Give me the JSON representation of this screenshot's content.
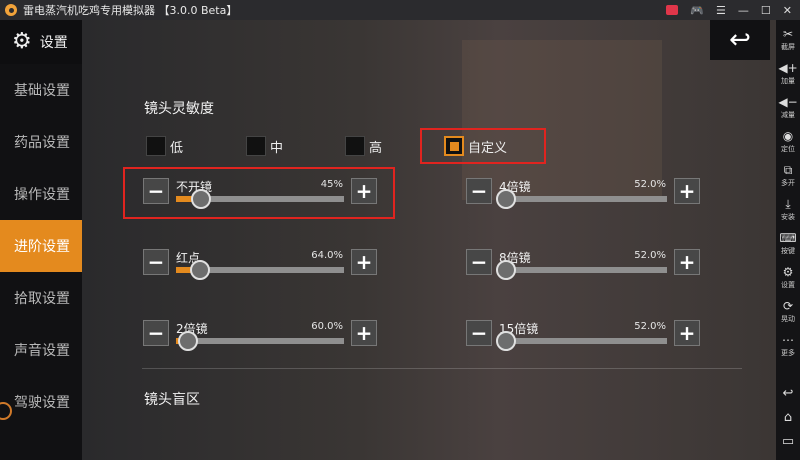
{
  "window": {
    "title": "雷电蒸汽机吃鸡专用模拟器 【3.0.0 Beta】",
    "controls": [
      "☰",
      "—",
      "☐",
      "✕"
    ]
  },
  "sidebar": {
    "title": "设置",
    "items": [
      {
        "label": "基础设置",
        "active": false
      },
      {
        "label": "药品设置",
        "active": false
      },
      {
        "label": "操作设置",
        "active": false
      },
      {
        "label": "进阶设置",
        "active": true
      },
      {
        "label": "拾取设置",
        "active": false
      },
      {
        "label": "声音设置",
        "active": false
      },
      {
        "label": "驾驶设置",
        "active": false
      }
    ]
  },
  "main": {
    "back_icon": "↩",
    "sensitivity_title": "镜头灵敏度",
    "modes": [
      {
        "label": "低",
        "checked": false
      },
      {
        "label": "中",
        "checked": false
      },
      {
        "label": "高",
        "checked": false
      },
      {
        "label": "自定义",
        "checked": true
      }
    ],
    "sliders": [
      {
        "label": "不开镜",
        "value_text": "45%",
        "value": 0.15
      },
      {
        "label": "4倍镜",
        "value_text": "52.0%",
        "value": 0.04
      },
      {
        "label": "红点",
        "value_text": "64.0%",
        "value": 0.14
      },
      {
        "label": "8倍镜",
        "value_text": "52.0%",
        "value": 0.04
      },
      {
        "label": "2倍镜",
        "value_text": "60.0%",
        "value": 0.07
      },
      {
        "label": "15倍镜",
        "value_text": "52.0%",
        "value": 0.04
      }
    ],
    "blind_title": "镜头盲区",
    "minus": "−",
    "plus": "+"
  },
  "toolbar": [
    {
      "icon": "✂",
      "label": "截屏"
    },
    {
      "icon": "◀+",
      "label": "加量"
    },
    {
      "icon": "◀−",
      "label": "减量"
    },
    {
      "icon": "◉",
      "label": "定位"
    },
    {
      "icon": "⧉",
      "label": "多开"
    },
    {
      "icon": "⤓",
      "label": "安装"
    },
    {
      "icon": "⌨",
      "label": "按键"
    },
    {
      "icon": "⚙",
      "label": "设置"
    },
    {
      "icon": "⟳",
      "label": "晃动"
    },
    {
      "icon": "⋯",
      "label": "更多"
    }
  ],
  "nav_keys": [
    "↩",
    "⌂",
    "▭"
  ],
  "colors": {
    "accent": "#e48a1e",
    "highlight": "#e0241f"
  }
}
